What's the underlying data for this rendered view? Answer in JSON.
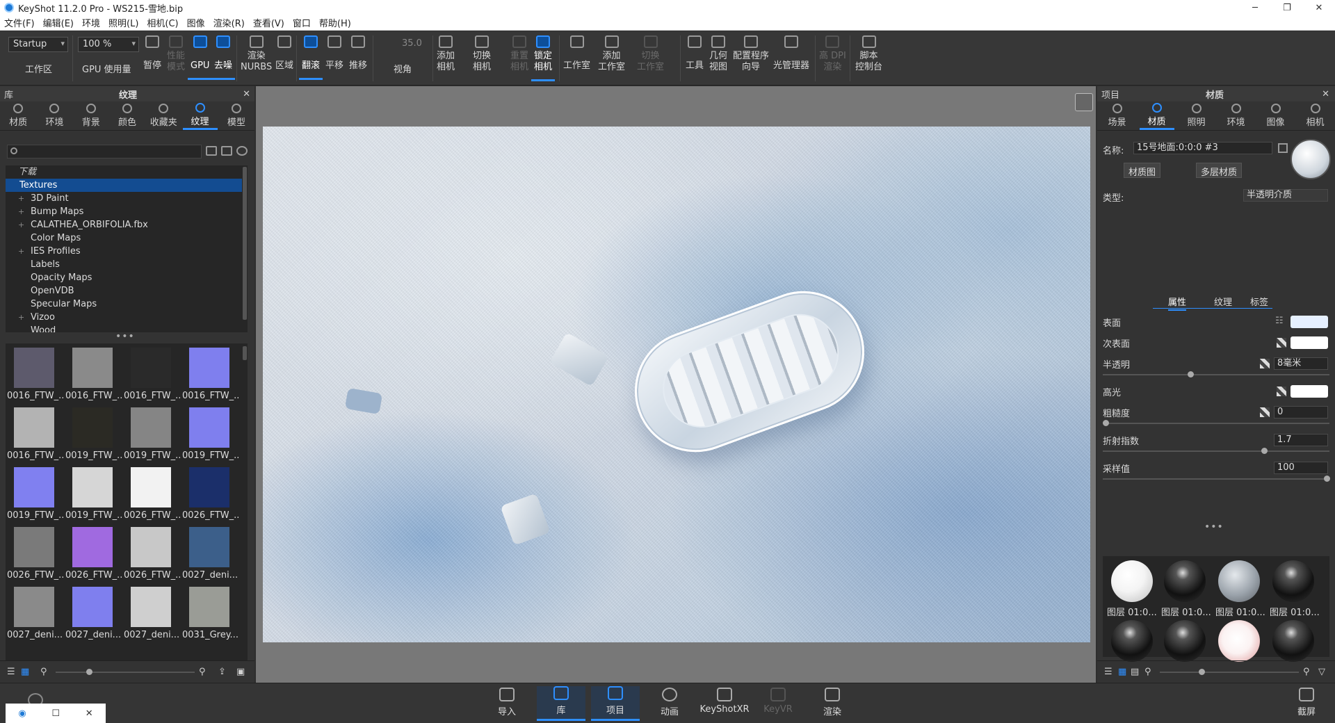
{
  "window": {
    "title": "KeyShot 11.2.0 Pro  - WS215-雪地.bip",
    "minimize": "─",
    "maximize": "❐",
    "close": "✕"
  },
  "menu": [
    "文件(F)",
    "编辑(E)",
    "环境",
    "照明(L)",
    "相机(C)",
    "图像",
    "渲染(R)",
    "查看(V)",
    "窗口",
    "帮助(H)"
  ],
  "toolbar": {
    "workspace_value": "Startup",
    "workspace_label": "工作区",
    "gpu_usage_value": "100 %",
    "gpu_usage_label": "GPU 使用量",
    "pause": "暂停",
    "perf_mode": "性能\n模式",
    "gpu": "GPU",
    "denoise": "去噪",
    "render_nurbs": "渲染\nNURBS",
    "region": "区域",
    "tumble": "翻滚",
    "pan": "平移",
    "dolly": "推移",
    "fov_value": "35.0",
    "fov_label": "视角",
    "add_camera": "添加\n相机",
    "switch_camera": "切换\n相机",
    "reset_camera": "重置\n相机",
    "lock_camera": "锁定\n相机",
    "studio": "工作室",
    "add_studio": "添加\n工作室",
    "switch_studio": "切换\n工作室",
    "tools": "工具",
    "geometry_view": "几何\n视图",
    "configurator_wizard": "配置程序\n向导",
    "light_manager": "光管理器",
    "hi_dpi": "高 DPI\n渲染",
    "script_console": "脚本\n控制台"
  },
  "library": {
    "header_left": "库",
    "header_title": "纹理",
    "tabs": [
      "材质",
      "环境",
      "背景",
      "颜色",
      "收藏夹",
      "纹理",
      "模型"
    ],
    "active_tab": "纹理",
    "tree": {
      "header": "下载",
      "selected": "Textures",
      "items": [
        "3D Paint",
        "Bump Maps",
        "CALATHEA_ORBIFOLIA.fbx",
        "Color Maps",
        "IES Profiles",
        "Labels",
        "Opacity Maps",
        "OpenVDB",
        "Specular Maps",
        "Vizoo",
        "Wood"
      ]
    },
    "thumbs": [
      {
        "label": "0016_FTW_...",
        "color": "#5d5a6c"
      },
      {
        "label": "0016_FTW_...",
        "color": "#8a8a8a"
      },
      {
        "label": "0016_FTW_...",
        "color": "#2a2a2a"
      },
      {
        "label": "0016_FTW_...",
        "color": "#7f7fee"
      },
      {
        "label": "0016_FTW_...",
        "color": "#b3b3b3"
      },
      {
        "label": "0019_FTW_...",
        "color": "#2b2a24"
      },
      {
        "label": "0019_FTW_...",
        "color": "#858585"
      },
      {
        "label": "0019_FTW_...",
        "color": "#7f7fee"
      },
      {
        "label": "0019_FTW_...",
        "color": "#8080f0"
      },
      {
        "label": "0019_FTW_...",
        "color": "#d6d6d6"
      },
      {
        "label": "0026_FTW_...",
        "color": "#f2f2f2"
      },
      {
        "label": "0026_FTW_...",
        "color": "#1b2f6a"
      },
      {
        "label": "0026_FTW_...",
        "color": "#7a7a7a"
      },
      {
        "label": "0026_FTW_...",
        "color": "#a06ae0"
      },
      {
        "label": "0026_FTW_...",
        "color": "#c8c8c8"
      },
      {
        "label": "0027_deni...",
        "color": "#3c5f8a"
      },
      {
        "label": "0027_deni...",
        "color": "#8a8a8a"
      },
      {
        "label": "0027_deni...",
        "color": "#7f7fee"
      },
      {
        "label": "0027_deni...",
        "color": "#cfcfcf"
      },
      {
        "label": "0031_Grey...",
        "color": "#9a9c96"
      }
    ]
  },
  "project": {
    "header_left": "项目",
    "header_title": "材质",
    "tabs": [
      "场景",
      "材质",
      "照明",
      "环境",
      "图像",
      "相机"
    ],
    "active_tab": "材质",
    "name_label": "名称:",
    "name_value": "15号地面:0:0:0 #3",
    "material_graph": "材质图",
    "multi_material": "多层材质",
    "type_label": "类型:",
    "type_value": "半透明介质",
    "subtabs": [
      "属性",
      "纹理",
      "标签"
    ],
    "props": {
      "surface": "表面",
      "subsurface": "次表面",
      "translucency": "半透明",
      "translucency_value": "8毫米",
      "specular": "高光",
      "roughness": "粗糙度",
      "roughness_value": "0",
      "ior": "折射指数",
      "ior_value": "1.7",
      "samples": "采样值",
      "samples_value": "100"
    },
    "colors": {
      "surface": "#e6f0ff",
      "subsurface": "#ffffff",
      "specular": "#ffffff"
    },
    "materials": [
      "图层 01:0...",
      "图层 01:0...",
      "图层 01:0...",
      "图层 01:0..."
    ]
  },
  "bottom": {
    "import": "导入",
    "library": "库",
    "project": "项目",
    "animation": "动画",
    "keyshotxr": "KeyShotXR",
    "keyvr": "KeyVR",
    "render": "渲染",
    "screenshot": "截屏"
  }
}
